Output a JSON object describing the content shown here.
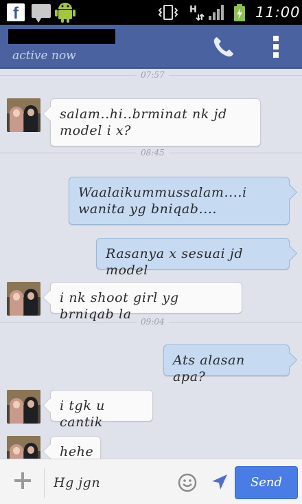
{
  "status_bar": {
    "time": "11:00",
    "fb_glyph": "f"
  },
  "header": {
    "presence": "active now",
    "icons": [
      "phone-icon",
      "overflow-menu-icon"
    ]
  },
  "thread": {
    "dividers": [
      "07:57",
      "08:45",
      "09:04"
    ],
    "messages": [
      {
        "from": "them",
        "text": "salam..hi..brminat nk jd model i x?"
      },
      {
        "from": "me",
        "text": "Waalaikummussalam....i wanita yg bniqab...."
      },
      {
        "from": "me",
        "text": "Rasanya x sesuai jd model"
      },
      {
        "from": "them",
        "text": "i nk shoot girl yg brniqab la"
      },
      {
        "from": "me",
        "text": "Ats alasan apa?"
      },
      {
        "from": "them",
        "text": "i tgk u cantik"
      },
      {
        "from": "them",
        "text": "hehe"
      }
    ]
  },
  "composer": {
    "input_value": "Hg jgn",
    "send_label": "Send",
    "icons": [
      "plus-icon",
      "smiley-icon",
      "location-arrow-icon"
    ]
  },
  "colors": {
    "header": "#4a63a0",
    "outgoing_bubble": "#c6daf2",
    "incoming_bubble": "#fafafa",
    "send_button": "#4a7ce6"
  }
}
